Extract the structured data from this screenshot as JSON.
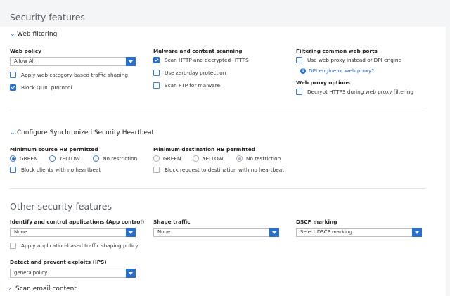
{
  "titles": {
    "security_features": "Security features",
    "other_security_features": "Other security features"
  },
  "web_filtering": {
    "section_label": "Web filtering",
    "web_policy_label": "Web policy",
    "web_policy_value": "Allow All",
    "apply_shaping_label": "Apply web category-based traffic shaping",
    "apply_shaping_checked": false,
    "block_quic_label": "Block QUIC protocol",
    "block_quic_checked": true,
    "malware_label": "Malware and content scanning",
    "scan_http_label": "Scan HTTP and decrypted HTTPS",
    "scan_http_checked": true,
    "zero_day_label": "Use zero-day protection",
    "zero_day_checked": false,
    "scan_ftp_label": "Scan FTP for malware",
    "scan_ftp_checked": false,
    "filtering_ports_label": "Filtering common web ports",
    "use_proxy_label": "Use web proxy instead of DPI engine",
    "use_proxy_checked": false,
    "dpi_link": "DPI engine or web proxy?",
    "proxy_options_label": "Web proxy options",
    "decrypt_label": "Decrypt HTTPS during web proxy filtering",
    "decrypt_checked": false
  },
  "heartbeat": {
    "section_label": "Configure Synchronized Security Heartbeat",
    "min_source_label": "Minimum source HB permitted",
    "source_options": [
      "GREEN",
      "YELLOW",
      "No restriction"
    ],
    "source_selected": "GREEN",
    "block_no_hb_label": "Block clients with no heartbeat",
    "min_dest_label": "Minimum destination HB permitted",
    "dest_options": [
      "GREEN",
      "YELLOW",
      "No restriction"
    ],
    "dest_selected": "No restriction",
    "block_dest_label": "Block request to destination with no heartbeat"
  },
  "other": {
    "app_control_label": "Identify and control applications (App control)",
    "app_control_value": "None",
    "app_shaping_label": "Apply application-based traffic shaping policy",
    "shape_traffic_label": "Shape traffic",
    "shape_traffic_value": "None",
    "dscp_label": "DSCP marking",
    "dscp_value": "Select DSCP marking",
    "ips_label": "Detect and prevent exploits (IPS)",
    "ips_value": "generalpolicy",
    "scan_email_label": "Scan email content"
  },
  "colors": {
    "accent": "#2a6fc9",
    "background": "#f4f5f7",
    "panel": "#ffffff"
  }
}
